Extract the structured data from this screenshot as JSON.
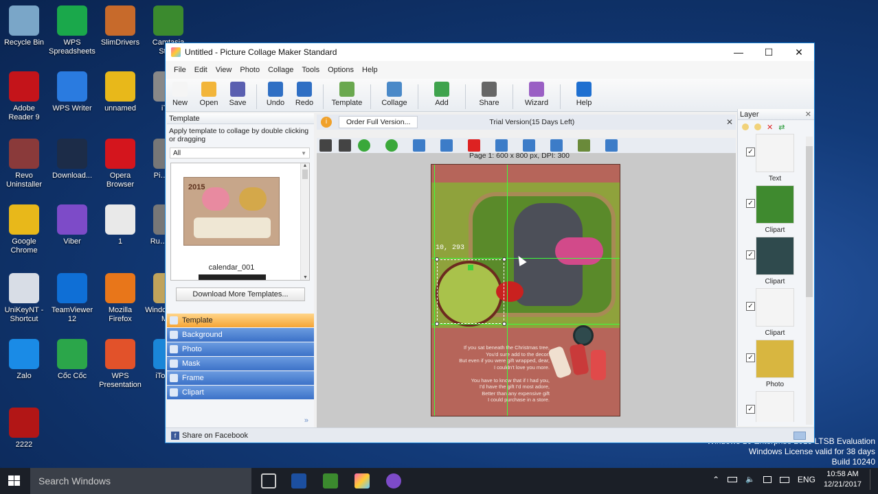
{
  "desktop_icons": [
    {
      "label": "Recycle Bin",
      "color": "#7aa6c8"
    },
    {
      "label": "WPS Spreadsheets",
      "color": "#1aa84b"
    },
    {
      "label": "SlimDrivers",
      "color": "#c76a2b"
    },
    {
      "label": "Camtasia Stu…",
      "color": "#3b8a2e"
    },
    {
      "label": "Adobe Reader 9",
      "color": "#c4141a"
    },
    {
      "label": "WPS Writer",
      "color": "#2a7be0"
    },
    {
      "label": "unnamed",
      "color": "#e8b81a"
    },
    {
      "label": "iT…",
      "color": "#888"
    },
    {
      "label": "Revo Uninstaller",
      "color": "#8a3a3a"
    },
    {
      "label": "Download...",
      "color": "#1c2c48"
    },
    {
      "label": "Opera Browser",
      "color": "#d4151d"
    },
    {
      "label": "Pi… C…",
      "color": "#777"
    },
    {
      "label": "Google Chrome",
      "color": "#e8b81a"
    },
    {
      "label": "Viber",
      "color": "#7d4bc8"
    },
    {
      "label": "1",
      "color": "#e9e9e9"
    },
    {
      "label": "Ru… Su…",
      "color": "#777"
    },
    {
      "label": "UniKeyNT - Shortcut",
      "color": "#d8dde6"
    },
    {
      "label": "TeamViewer 12",
      "color": "#0f6fd6"
    },
    {
      "label": "Mozilla Firefox",
      "color": "#e8761a"
    },
    {
      "label": "Windows Live Mail",
      "color": "#c0a35b"
    },
    {
      "label": "Zalo",
      "color": "#1a8be6"
    },
    {
      "label": "Cốc Cốc",
      "color": "#2ba64a"
    },
    {
      "label": "WPS Presentation",
      "color": "#e2522a"
    },
    {
      "label": "iTools 3",
      "color": "#1a86d8"
    },
    {
      "label": "2222",
      "color": "#b21616"
    }
  ],
  "window": {
    "title": "Untitled - Picture Collage Maker Standard",
    "controls": {
      "minimize": "—",
      "maximize": "☐",
      "close": "✕"
    },
    "menu": [
      "File",
      "Edit",
      "View",
      "Photo",
      "Collage",
      "Tools",
      "Options",
      "Help"
    ],
    "toolbar": [
      {
        "label": "New",
        "color": "#f5f5f5"
      },
      {
        "label": "Open",
        "color": "#f2b53a"
      },
      {
        "label": "Save",
        "color": "#5a5fb0"
      },
      {
        "label": "Undo",
        "color": "#2f6fc4"
      },
      {
        "label": "Redo",
        "color": "#2f6fc4"
      },
      {
        "label": "Template",
        "color": "#6aa84f"
      },
      {
        "label": "Collage",
        "color": "#4a89c8"
      },
      {
        "label": "Add",
        "color": "#3fa34d"
      },
      {
        "label": "Share",
        "color": "#666"
      },
      {
        "label": "Wizard",
        "color": "#9a5fc4"
      },
      {
        "label": "Help",
        "color": "#1e6fd0"
      }
    ]
  },
  "template_panel": {
    "header": "Template",
    "hint": "Apply template to collage by double clicking or dragging",
    "filter": "All",
    "item_caption": "calendar_001",
    "thumb_year": "2015",
    "download_button": "Download More Templates..."
  },
  "nav": [
    {
      "label": "Template",
      "active": true
    },
    {
      "label": "Background",
      "active": false
    },
    {
      "label": "Photo",
      "active": false
    },
    {
      "label": "Mask",
      "active": false
    },
    {
      "label": "Frame",
      "active": false
    },
    {
      "label": "Clipart",
      "active": false
    }
  ],
  "center": {
    "order_button": "Order Full Version...",
    "trial": "Trial Version(15 Days Left)",
    "page_info": "Page 1: 600 x 800 px, DPI: 300",
    "coord_readout": "10, 293",
    "poem": [
      "If you sat beneath the Christmas tree,",
      "You'd sure add to the decor.",
      "But even if you were gift wrapped, dear,",
      "I couldn't love you more.",
      "",
      "You have to know that if I had you,",
      "I'd have the gift I'd most adore,",
      "Better than any expensive gift",
      "I could purchase in a store."
    ]
  },
  "layer_panel": {
    "header": "Layer",
    "items": [
      {
        "label": "Text"
      },
      {
        "label": "Clipart"
      },
      {
        "label": "Clipart"
      },
      {
        "label": "Clipart"
      },
      {
        "label": "Photo"
      },
      {
        "label": ""
      }
    ]
  },
  "status": {
    "share": "Share on Facebook"
  },
  "watermark": [
    "Windows 10 Enterprise 2015 LTSB Evaluation",
    "Windows License valid for 38 days",
    "Build 10240"
  ],
  "taskbar": {
    "search": "Search Windows",
    "lang": "ENG",
    "time": "10:58 AM",
    "date": "12/21/2017"
  }
}
